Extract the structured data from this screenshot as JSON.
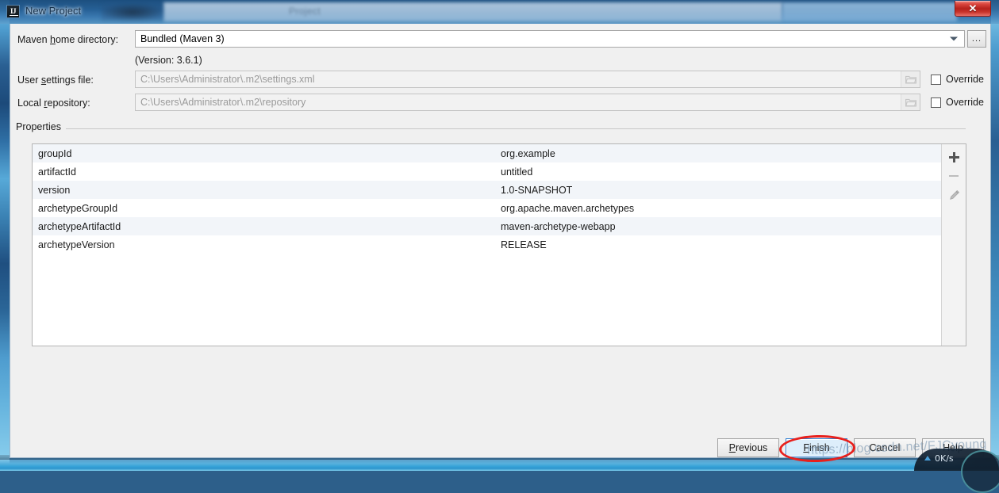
{
  "window": {
    "title": "New Project",
    "app_icon": "intellij-idea-icon",
    "close_label": "✕",
    "ghost_tab_text": "Project"
  },
  "form": {
    "maven_home": {
      "label_before": "Maven ",
      "label_mnemonic": "h",
      "label_after": "ome directory:",
      "value": "Bundled (Maven 3)",
      "browse_label": "...",
      "version_note": "(Version: 3.6.1)"
    },
    "user_settings": {
      "label_before": "User ",
      "label_mnemonic": "s",
      "label_after": "ettings file:",
      "value": "C:\\Users\\Administrator\\.m2\\settings.xml",
      "override_label": "Override",
      "override_checked": false
    },
    "local_repository": {
      "label_before": "Local ",
      "label_mnemonic": "r",
      "label_after": "epository:",
      "value": "C:\\Users\\Administrator\\.m2\\repository",
      "override_label": "Override",
      "override_checked": false
    }
  },
  "properties": {
    "group_title": "Properties",
    "rows": [
      {
        "key": "groupId",
        "value": "org.example"
      },
      {
        "key": "artifactId",
        "value": "untitled"
      },
      {
        "key": "version",
        "value": "1.0-SNAPSHOT"
      },
      {
        "key": "archetypeGroupId",
        "value": "org.apache.maven.archetypes"
      },
      {
        "key": "archetypeArtifactId",
        "value": "maven-archetype-webapp"
      },
      {
        "key": "archetypeVersion",
        "value": "RELEASE"
      }
    ],
    "toolbar": {
      "add_icon": "plus-icon",
      "remove_icon": "minus-icon",
      "edit_icon": "pencil-icon"
    }
  },
  "footer": {
    "previous": {
      "before": "",
      "mnemonic": "P",
      "after": "revious"
    },
    "finish": {
      "before": "",
      "mnemonic": "F",
      "after": "inish"
    },
    "cancel": {
      "before": "",
      "mnemonic": "",
      "after": "Cancel"
    },
    "help": {
      "before": "",
      "mnemonic": "",
      "after": "Help"
    }
  },
  "overlay": {
    "watermark": "https://blog.csdn.net/FJCyoung",
    "annotation_color": "#e8201c"
  },
  "netspeed": {
    "rate": "0K/s",
    "arrow_icon": "arrow-up-icon"
  }
}
